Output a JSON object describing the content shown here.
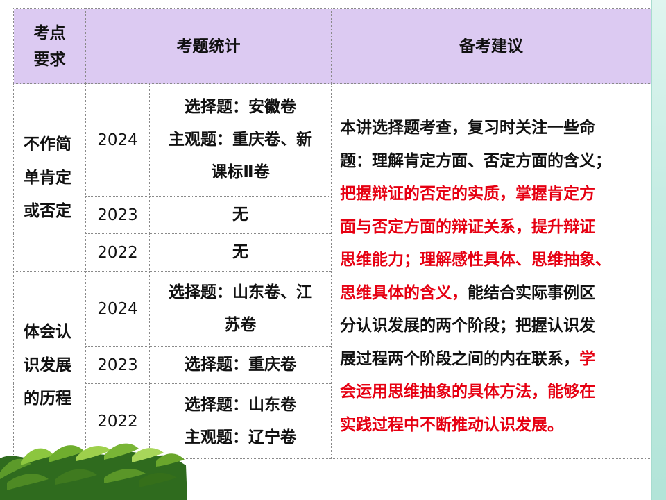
{
  "header": {
    "col1_line1": "考点",
    "col1_line2": "要求",
    "col2": "考题统计",
    "col3": "备考建议"
  },
  "topics": [
    {
      "lines": [
        "不作简",
        "单肯定",
        "或否定"
      ],
      "rows": [
        {
          "year": "2024",
          "stat_lines": [
            "选择题：安徽卷",
            "主观题：重庆卷、新",
            "课标Ⅱ卷"
          ]
        },
        {
          "year": "2023",
          "stat_lines": [
            "无"
          ]
        },
        {
          "year": "2022",
          "stat_lines": [
            "无"
          ]
        }
      ]
    },
    {
      "lines": [
        "体会认",
        "识发展",
        "的历程"
      ],
      "rows": [
        {
          "year": "2024",
          "stat_lines": [
            "选择题：山东卷、江",
            "苏卷"
          ]
        },
        {
          "year": "2023",
          "stat_lines": [
            "选择题：重庆卷"
          ]
        },
        {
          "year": "2022",
          "stat_lines": [
            "选择题：山东卷",
            "主观题：辽宁卷"
          ]
        }
      ]
    }
  ],
  "advice": {
    "lines": [
      [
        {
          "t": "本讲选择题考查，复习时关注一些命",
          "red": false
        }
      ],
      [
        {
          "t": "题：理解肯定方面、否定方面的含义；",
          "red": false
        }
      ],
      [
        {
          "t": "把握辩证的否定的实质，掌握肯定方",
          "red": true
        }
      ],
      [
        {
          "t": "面与否定方面的辩证关系，提升辩证",
          "red": true
        }
      ],
      [
        {
          "t": "思维能力；理解感性具体、思维抽象、",
          "red": true
        }
      ],
      [
        {
          "t": "思维具体的含义，",
          "red": true
        },
        {
          "t": "能结合实际事例区",
          "red": false
        }
      ],
      [
        {
          "t": "分认识发展的两个阶段；把握认识发",
          "red": false
        }
      ],
      [
        {
          "t": "展过程两个阶段之间的内在联系，",
          "red": false
        },
        {
          "t": "学",
          "red": true
        }
      ],
      [
        {
          "t": "会运用思维抽象的具体方法，能够在",
          "red": true
        }
      ],
      [
        {
          "t": "实践过程中不断推动认识发展。",
          "red": true
        }
      ]
    ]
  },
  "colors": {
    "header_bg": "#dccaf2",
    "accent_red": "#e60012",
    "side_bar": "#c5ece3"
  }
}
